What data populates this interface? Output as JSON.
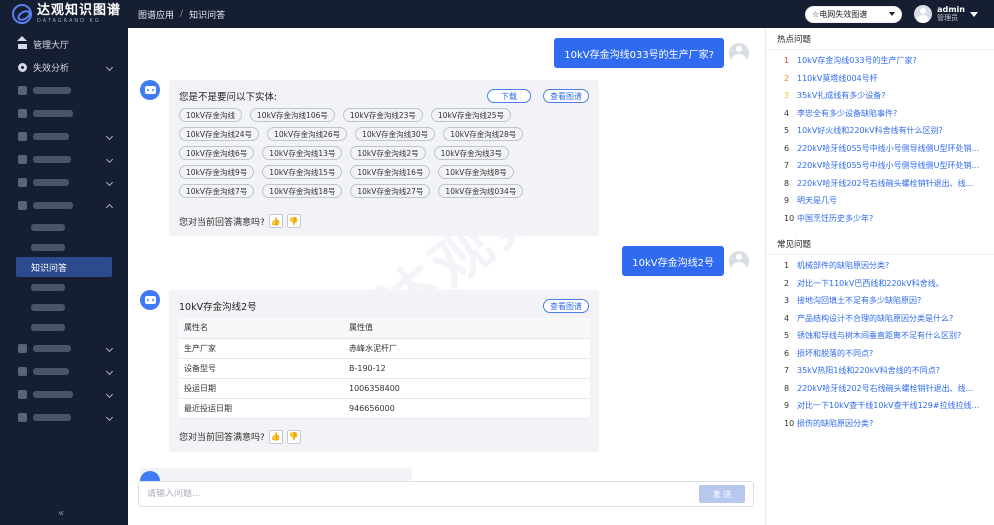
{
  "app": {
    "name": "达观知识图谱",
    "name_en": "DATAGRAND KG"
  },
  "breadcrumb": [
    "图谱应用",
    "知识问答"
  ],
  "header": {
    "graph_select": "☆电网失效图谱",
    "user_name": "admin",
    "user_role": "管理员"
  },
  "sidebar": {
    "items": [
      {
        "label": "管理大厅"
      },
      {
        "label": "失效分析"
      }
    ],
    "active_sub": "知识问答",
    "collapse": "«"
  },
  "chat": {
    "q1": "10kV存金沟线033号的生产厂家?",
    "a1": {
      "title": "您是不是要问以下实体:",
      "download": "下载",
      "view_graph": "查看图谱",
      "tags": [
        "10kV存金沟线",
        "10kV存金沟线106号",
        "10kV存金沟线23号",
        "10kV存金沟线25号",
        "10kV存金沟线24号",
        "10kV存金沟线26号",
        "10kV存金沟线30号",
        "10kV存金沟线28号",
        "10kV存金沟线6号",
        "10kV存金沟线13号",
        "10kV存金沟线2号",
        "10kV存金沟线3号",
        "10kV存金沟线9号",
        "10kV存金沟线15号",
        "10kV存金沟线16号",
        "10kV存金沟线8号",
        "10kV存金沟线7号",
        "10kV存金沟线18号",
        "10kV存金沟线27号",
        "10kV存金沟线034号"
      ],
      "satisfaction": "您对当前回答满意吗?"
    },
    "q2": "10kV存金沟线2号",
    "a2": {
      "title": "10kV存金沟线2号",
      "view_graph": "查看图谱",
      "col_name": "属性名",
      "col_value": "属性值",
      "rows": [
        [
          "生产厂家",
          "赤峰水泥杆厂"
        ],
        [
          "设备型号",
          "B-190-12"
        ],
        [
          "投运日期",
          "1006358400"
        ],
        [
          "最近投运日期",
          "946656000"
        ]
      ],
      "satisfaction": "您对当前回答满意吗?"
    },
    "input_placeholder": "请输入问题...",
    "send": "发 送"
  },
  "hot": {
    "title": "热点问题",
    "items": [
      "10kV存金沟线033号的生产厂家?",
      "110kV莫塔线004号杆",
      "35kV扎成线有多少设备?",
      "李忠全有多少设备缺陷事件?",
      "10kV好火线和220kV科舍线有什么区别?",
      "220kV哈牙线055号中线小号侧导线侧U型环处销...",
      "220kV哈牙线055号中线小号侧导线侧U型环处销...",
      "220kV哈牙线202号右线碗头螺栓销针退出、线...",
      "明天是几号",
      "中国烹饪历史多少年?"
    ]
  },
  "common": {
    "title": "常见问题",
    "items": [
      "机械部件的缺陷原因分类?",
      "对比一下110kV巴西线和220kV科舍线。",
      "接地沟回填土不足有多少缺陷原因?",
      "产品结构设计不合理的缺陷原因分类是什么?",
      "锈蚀和导线与树木间垂直距离不足有什么区别?",
      "损坏和脱落的不同点?",
      "35kV热阳1线和220kV科舍线的不同点?",
      "220kV哈牙线202号右线碗头螺栓销针退出、线...",
      "对比一下10kV查干线10kV查干线129#拉线拉线...",
      "损伤的缺陷原因分类?"
    ]
  },
  "colors": {
    "accent": "#2f6af0",
    "dark": "#161e31",
    "rank1": "#e23c3c",
    "rank2": "#f07f22",
    "rank3": "#f0b82a"
  }
}
